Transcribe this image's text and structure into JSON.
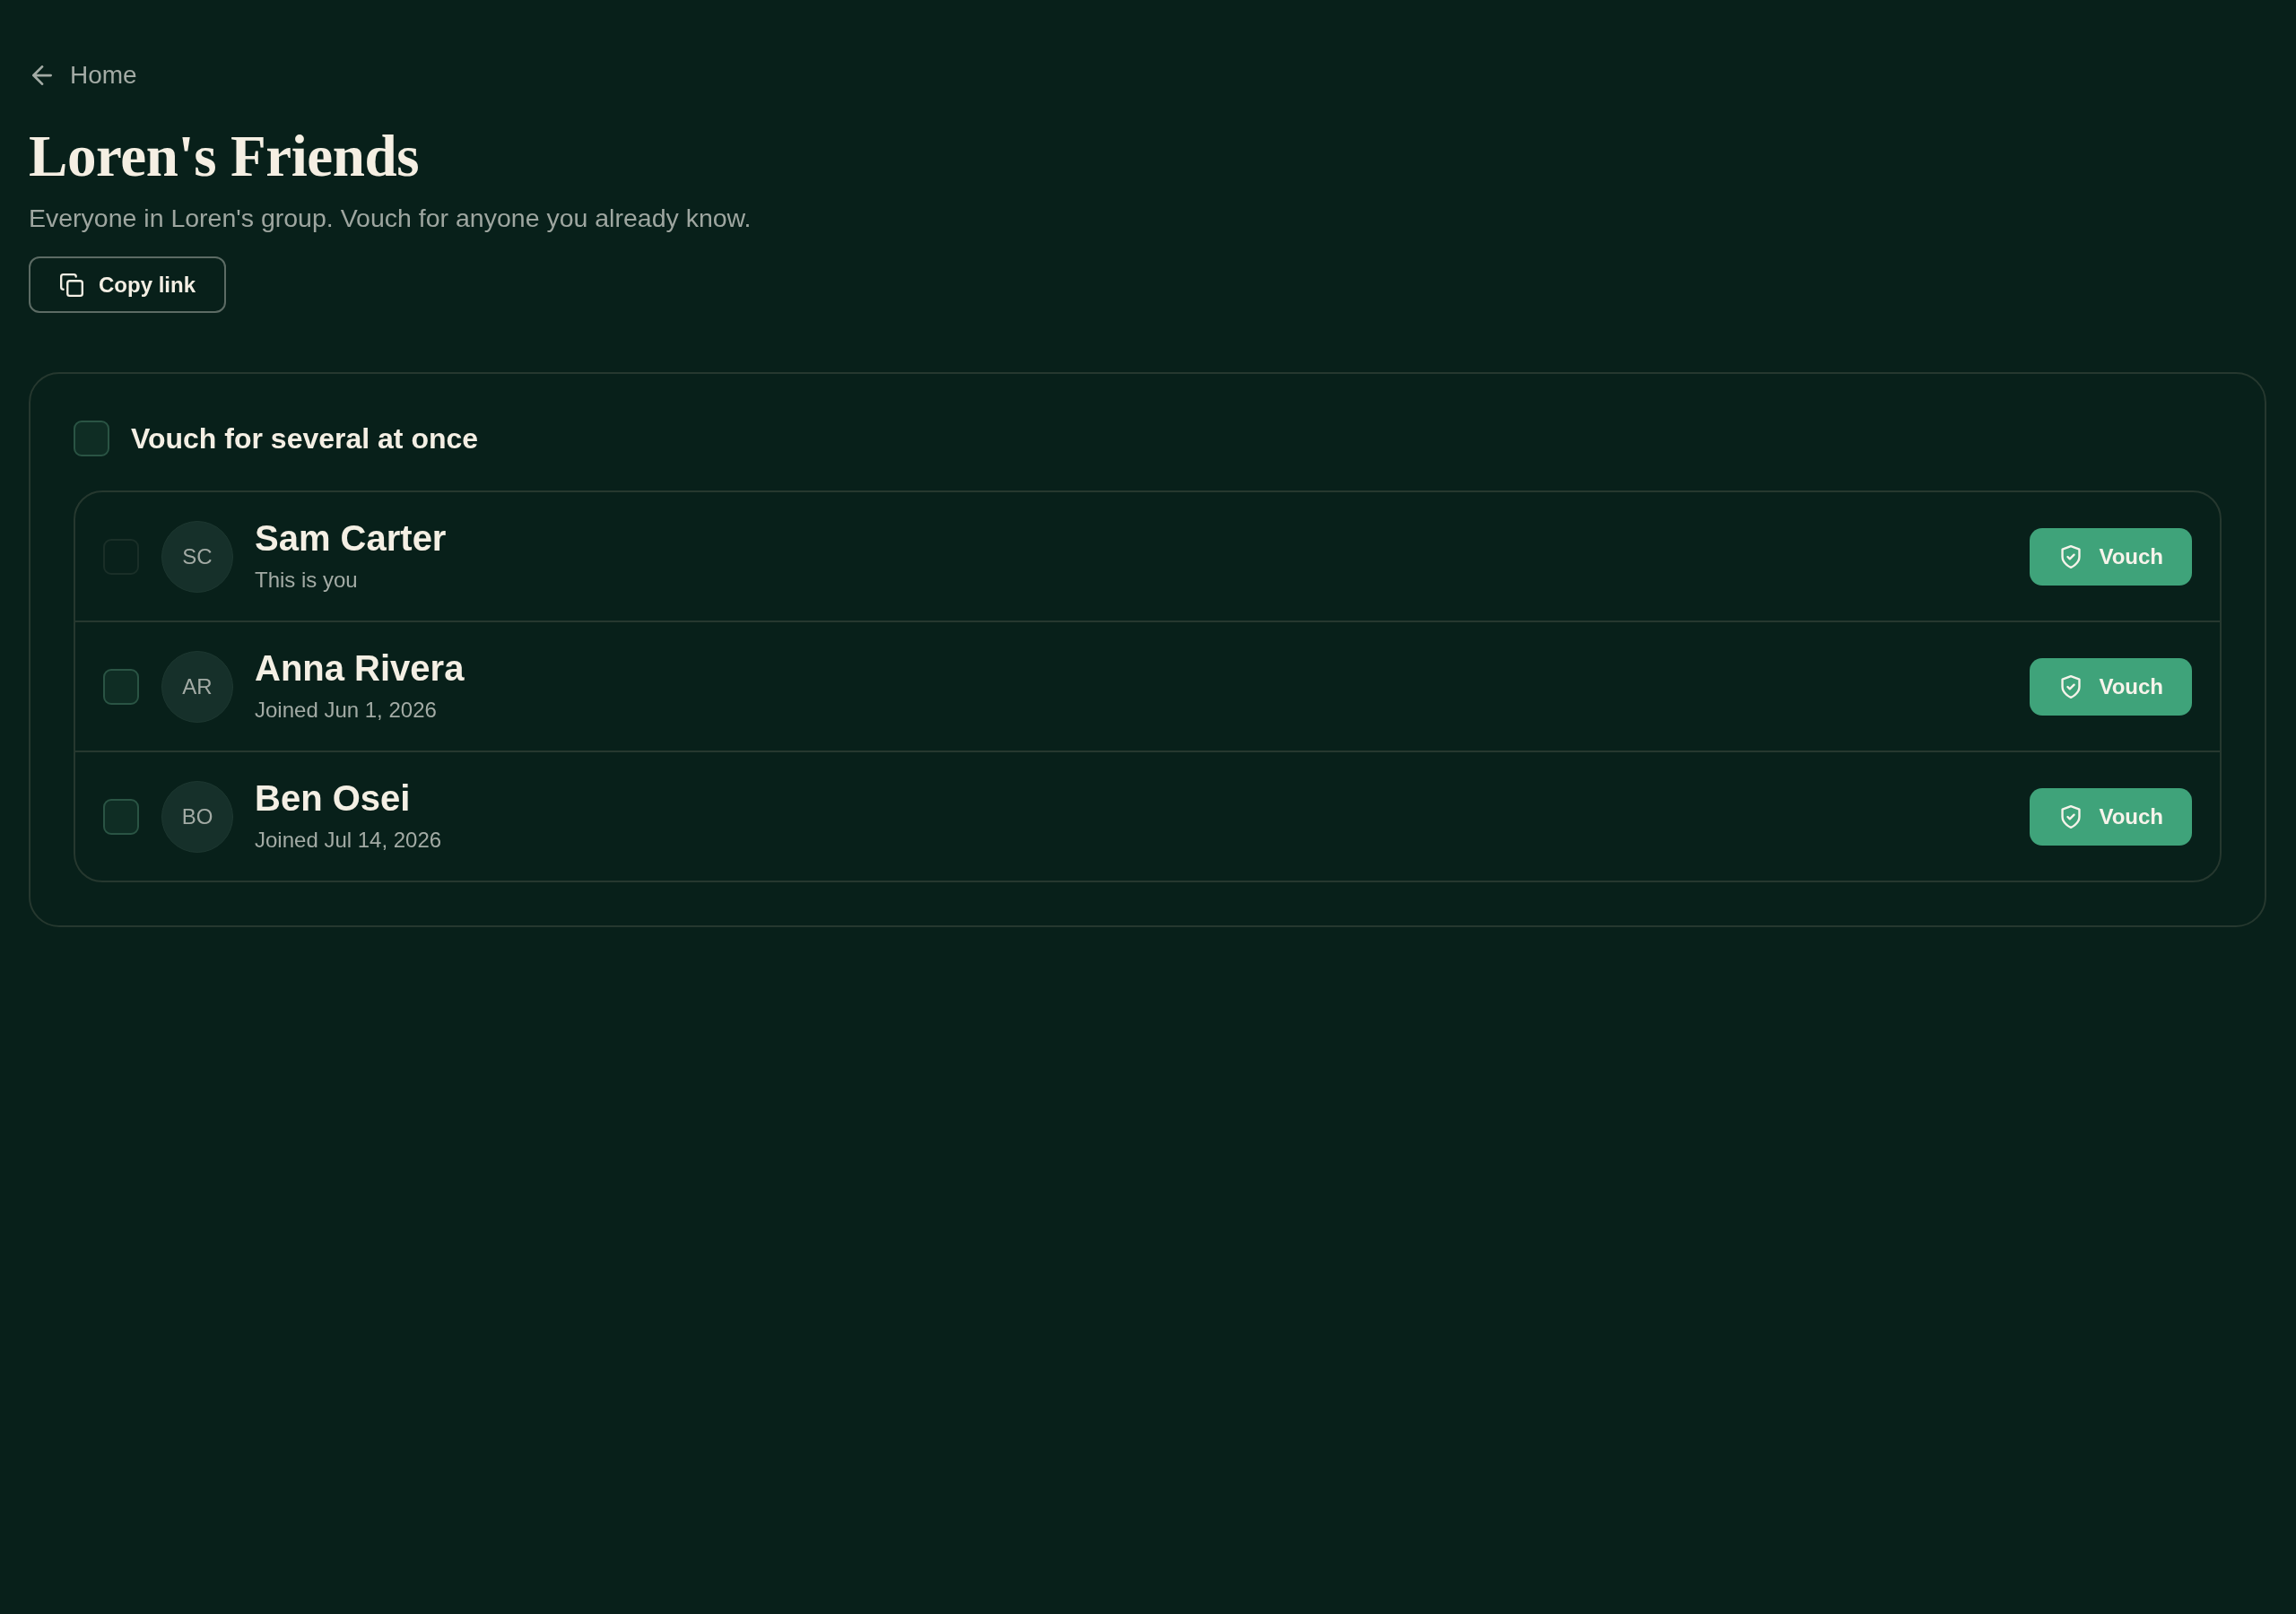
{
  "back_link": {
    "label": "Home"
  },
  "header": {
    "title": "Loren's Friends",
    "subtitle": "Everyone in Loren's group. Vouch for anyone you already know.",
    "copy_button": "Copy link"
  },
  "select_all": {
    "label": "Vouch for several at once",
    "checked": false
  },
  "members": [
    {
      "initials": "SC",
      "name": "Sam Carter",
      "subtitle": "This is you",
      "checked": false,
      "disabled": true,
      "button": "Vouch"
    },
    {
      "initials": "AR",
      "name": "Anna Rivera",
      "subtitle": "Joined Jun 1, 2026",
      "checked": false,
      "disabled": false,
      "button": "Vouch"
    },
    {
      "initials": "BO",
      "name": "Ben Osei",
      "subtitle": "Joined Jul 14, 2026",
      "checked": false,
      "disabled": false,
      "button": "Vouch"
    }
  ]
}
